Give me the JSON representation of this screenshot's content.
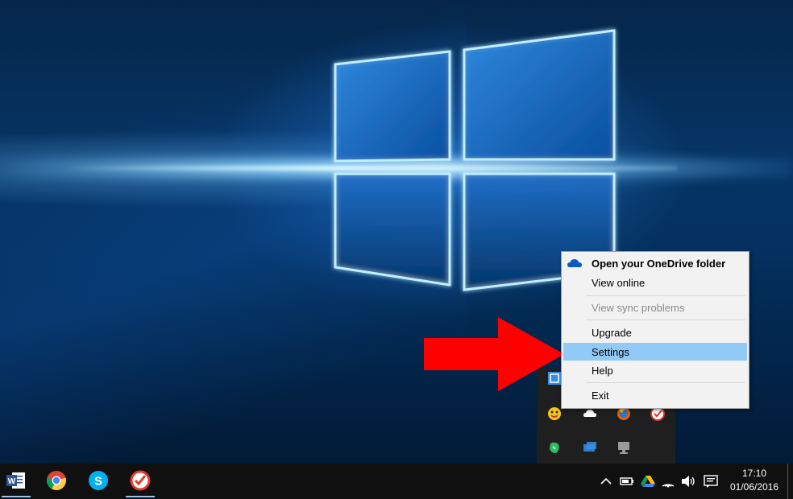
{
  "onedrive_menu": {
    "items": [
      {
        "label": "Open your OneDrive folder",
        "bold": true,
        "disabled": false,
        "highlight": false
      },
      {
        "label": "View online",
        "bold": false,
        "disabled": false,
        "highlight": false
      },
      {
        "label": "View sync problems",
        "bold": false,
        "disabled": true,
        "highlight": false
      },
      {
        "label": "Upgrade",
        "bold": false,
        "disabled": false,
        "highlight": false
      },
      {
        "label": "Settings",
        "bold": false,
        "disabled": false,
        "highlight": true
      },
      {
        "label": "Help",
        "bold": false,
        "disabled": false,
        "highlight": false
      },
      {
        "label": "Exit",
        "bold": false,
        "disabled": false,
        "highlight": false
      }
    ],
    "icon": "onedrive-cloud-icon"
  },
  "taskbar": {
    "apps": [
      {
        "name": "word-icon",
        "running": true
      },
      {
        "name": "chrome-icon",
        "running": false
      },
      {
        "name": "skype-icon",
        "running": false
      },
      {
        "name": "wunderlist-icon",
        "running": true
      }
    ],
    "system_tray": [
      "chevron-up-icon",
      "battery-icon",
      "google-drive-icon",
      "wifi-icon",
      "volume-icon",
      "action-center-icon"
    ],
    "clock": {
      "time": "17:10",
      "date": "01/06/2016"
    }
  },
  "tray_overflow": {
    "icons": [
      "screen-capture-icon",
      "emoji-app-icon",
      "onedrive-icon",
      "firefox-icon",
      "wunderlist-icon",
      "evernote-icon",
      "network-drive-icon",
      "display-icon"
    ]
  },
  "colors": {
    "menu_highlight": "#91c9f7",
    "arrow": "#ff0000",
    "onedrive_blue": "#0a5bc4",
    "taskbar": "#101010"
  }
}
